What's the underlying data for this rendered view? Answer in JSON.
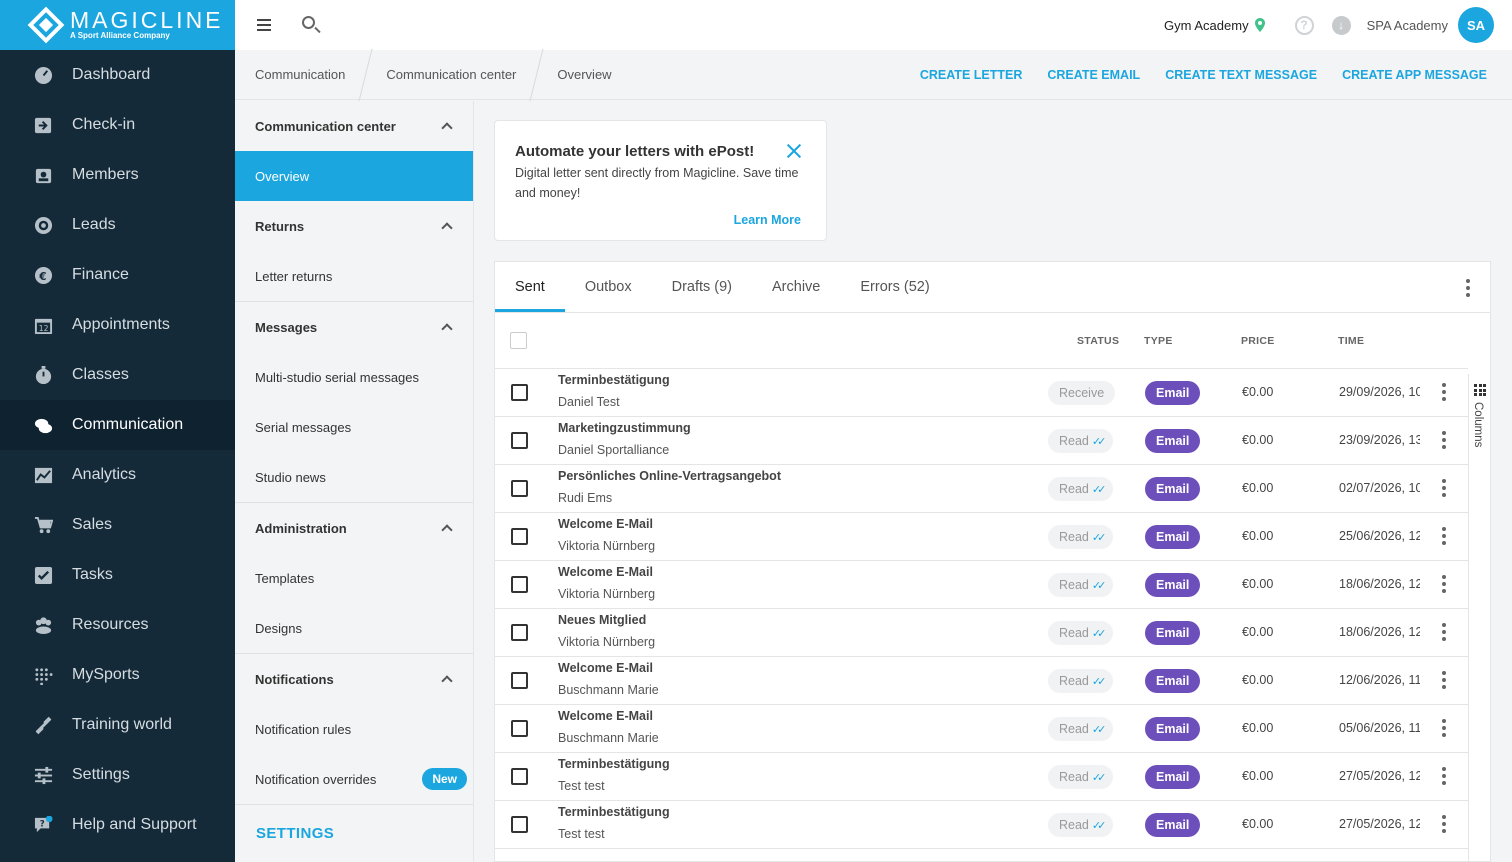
{
  "brand": {
    "name": "MAGICLINE",
    "tagline": "A Sport Alliance Company",
    "accent": "#1ba6df"
  },
  "nav": [
    {
      "label": "Dashboard",
      "icon": "dashboard-icon"
    },
    {
      "label": "Check-in",
      "icon": "check-in-icon"
    },
    {
      "label": "Members",
      "icon": "members-icon"
    },
    {
      "label": "Leads",
      "icon": "leads-icon"
    },
    {
      "label": "Finance",
      "icon": "euro-icon"
    },
    {
      "label": "Appointments",
      "icon": "calendar-icon"
    },
    {
      "label": "Classes",
      "icon": "classes-icon"
    },
    {
      "label": "Communication",
      "icon": "chat-icon"
    },
    {
      "label": "Analytics",
      "icon": "analytics-icon"
    },
    {
      "label": "Sales",
      "icon": "cart-icon"
    },
    {
      "label": "Tasks",
      "icon": "tasks-icon"
    },
    {
      "label": "Resources",
      "icon": "resources-icon"
    },
    {
      "label": "MySports",
      "icon": "mysports-icon"
    },
    {
      "label": "Training world",
      "icon": "dumbbell-icon"
    },
    {
      "label": "Settings",
      "icon": "sliders-icon"
    },
    {
      "label": "Help and Support",
      "icon": "help-support-icon"
    }
  ],
  "topbar": {
    "studio": "Gym Academy",
    "help": "?",
    "download": "↓",
    "account": "SPA Academy",
    "initials": "SA"
  },
  "breadcrumb": [
    "Communication",
    "Communication center",
    "Overview"
  ],
  "actions": [
    "CREATE LETTER",
    "CREATE EMAIL",
    "CREATE TEXT MESSAGE",
    "CREATE APP MESSAGE"
  ],
  "submenu": {
    "sections": [
      {
        "title": "Communication center",
        "items": [
          "Overview"
        ]
      },
      {
        "title": "Returns",
        "items": [
          "Letter returns"
        ]
      },
      {
        "title": "Messages",
        "items": [
          "Multi-studio serial messages",
          "Serial messages",
          "Studio news"
        ]
      },
      {
        "title": "Administration",
        "items": [
          "Templates",
          "Designs"
        ]
      },
      {
        "title": "Notifications",
        "items": [
          "Notification rules",
          "Notification overrides"
        ]
      }
    ],
    "new_badge": "New",
    "settings": "SETTINGS"
  },
  "promo": {
    "title": "Automate your letters with ePost!",
    "text": "Digital letter sent directly from Magicline. Save time and money!",
    "link": "Learn More"
  },
  "tabs": [
    "Sent",
    "Outbox",
    "Drafts (9)",
    "Archive",
    "Errors (52)"
  ],
  "columns": {
    "status": "STATUS",
    "type": "TYPE",
    "price": "PRICE",
    "time": "TIME",
    "rail": "Columns"
  },
  "rows": [
    {
      "title": "Terminbestätigung",
      "name": "Daniel Test",
      "status": "Receive",
      "read": false,
      "type": "Email",
      "price": "€0.00",
      "time": "29/09/2026, 10"
    },
    {
      "title": "Marketingzustimmung",
      "name": "Daniel Sportalliance",
      "status": "Read",
      "read": true,
      "type": "Email",
      "price": "€0.00",
      "time": "23/09/2026, 13"
    },
    {
      "title": "Persönliches Online-Vertragsangebot",
      "name": "Rudi Ems",
      "status": "Read",
      "read": true,
      "type": "Email",
      "price": "€0.00",
      "time": "02/07/2026, 10"
    },
    {
      "title": "Welcome E-Mail",
      "name": "Viktoria Nürnberg",
      "status": "Read",
      "read": true,
      "type": "Email",
      "price": "€0.00",
      "time": "25/06/2026, 12"
    },
    {
      "title": "Welcome E-Mail",
      "name": "Viktoria Nürnberg",
      "status": "Read",
      "read": true,
      "type": "Email",
      "price": "€0.00",
      "time": "18/06/2026, 12"
    },
    {
      "title": "Neues Mitglied",
      "name": "Viktoria Nürnberg",
      "status": "Read",
      "read": true,
      "type": "Email",
      "price": "€0.00",
      "time": "18/06/2026, 12"
    },
    {
      "title": "Welcome E-Mail",
      "name": "Buschmann Marie",
      "status": "Read",
      "read": true,
      "type": "Email",
      "price": "€0.00",
      "time": "12/06/2026, 11"
    },
    {
      "title": "Welcome E-Mail",
      "name": "Buschmann Marie",
      "status": "Read",
      "read": true,
      "type": "Email",
      "price": "€0.00",
      "time": "05/06/2026, 11"
    },
    {
      "title": "Terminbestätigung",
      "name": "Test test",
      "status": "Read",
      "read": true,
      "type": "Email",
      "price": "€0.00",
      "time": "27/05/2026, 12"
    },
    {
      "title": "Terminbestätigung",
      "name": "Test test",
      "status": "Read",
      "read": true,
      "type": "Email",
      "price": "€0.00",
      "time": "27/05/2026, 12"
    }
  ],
  "colors": {
    "type_email": "#6c4fbb",
    "sidebar_bg": "#152a38"
  }
}
